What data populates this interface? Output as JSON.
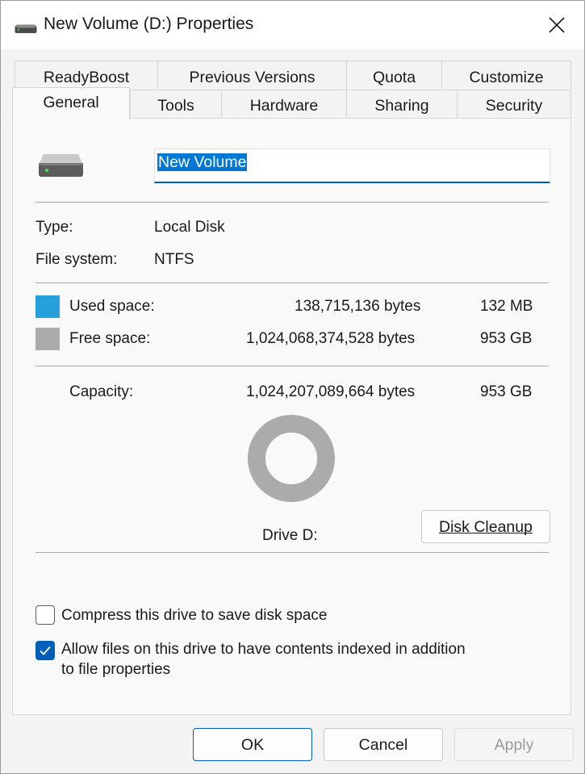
{
  "window": {
    "title": "New Volume (D:) Properties",
    "title_icon": "drive-icon",
    "close_icon": "close-icon"
  },
  "tabs": {
    "row1": [
      "ReadyBoost",
      "Previous Versions",
      "Quota",
      "Customize"
    ],
    "row2": [
      "General",
      "Tools",
      "Hardware",
      "Sharing",
      "Security"
    ],
    "active": "General"
  },
  "general": {
    "drive_icon": "drive-icon",
    "volume_name": "New Volume",
    "type_label": "Type:",
    "type_value": "Local Disk",
    "fs_label": "File system:",
    "fs_value": "NTFS",
    "used_label": "Used space:",
    "used_bytes": "138,715,136 bytes",
    "used_size": "132 MB",
    "used_color": "#26a0da",
    "free_label": "Free space:",
    "free_bytes": "1,024,068,374,528 bytes",
    "free_size": "953 GB",
    "free_color": "#ababab",
    "capacity_label": "Capacity:",
    "capacity_bytes": "1,024,207,089,664 bytes",
    "capacity_size": "953 GB",
    "used_fraction": 0.000135,
    "drive_label": "Drive D:",
    "cleanup_button": "Disk Cleanup",
    "compress_label": "Compress this drive to save disk space",
    "compress_checked": false,
    "index_label_line1": "Allow files on this drive to have contents indexed in addition",
    "index_label_line2": "to file properties",
    "index_checked": true,
    "accent_color": "#005fb8"
  },
  "footer": {
    "ok": "OK",
    "cancel": "Cancel",
    "apply": "Apply"
  }
}
